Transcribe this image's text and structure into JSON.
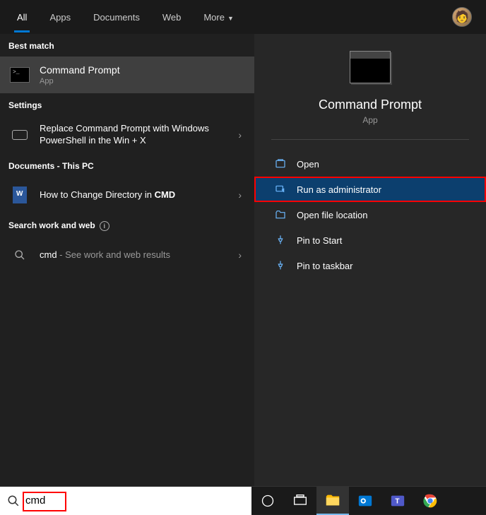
{
  "tabs": {
    "items": [
      "All",
      "Apps",
      "Documents",
      "Web",
      "More"
    ],
    "active_index": 0
  },
  "left": {
    "best_match_header": "Best match",
    "best_match": {
      "title": "Command Prompt",
      "sub": "App"
    },
    "settings_header": "Settings",
    "settings_item": "Replace Command Prompt with Windows PowerShell in the Win + X",
    "documents_header": "Documents - This PC",
    "documents_item_prefix": "How to Change Directory in ",
    "documents_item_bold": "CMD",
    "search_web_header": "Search work and web",
    "web_item_query": "cmd",
    "web_item_suffix": " - See work and web results"
  },
  "right": {
    "title": "Command Prompt",
    "sub": "App",
    "actions": [
      "Open",
      "Run as administrator",
      "Open file location",
      "Pin to Start",
      "Pin to taskbar"
    ],
    "highlighted_index": 1
  },
  "search": {
    "value": "cmd"
  }
}
